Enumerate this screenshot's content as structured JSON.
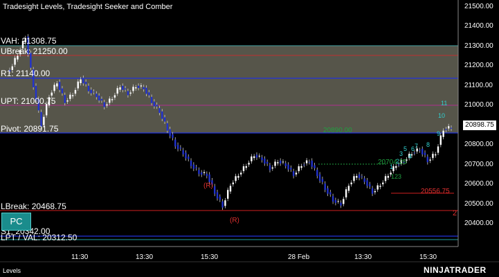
{
  "window": {
    "title": "Tradesight Levels, Tradesight Seeker and Comber",
    "panel_name": "Levels",
    "brand": "NINJATRADER"
  },
  "levels": {
    "vah": "VAH: 21308.75",
    "ubreak": "UBreak: 21250.00",
    "r1": "R1: 21140.00",
    "upt": "UPT: 21000.75",
    "pivot": "Pivot: 20891.75",
    "lbreak": "LBreak: 20468.75",
    "s1": "S1: 20342.00",
    "val": "LPT / VAL: 20312.50"
  },
  "annotations": {
    "r_mark_1": "(R)",
    "r_mark_2": "(R)",
    "ann_20704": "20704.25",
    "ann_20556": "20556.75",
    "ann_20890": "20890.00",
    "seq_11": "11",
    "seq_10": "10",
    "seq_9": "9",
    "seq_8": "8",
    "seq_7": "7",
    "seq_6": "6",
    "seq_5": "5",
    "seq_4": "4",
    "seq_3": "3",
    "seq_2": "2",
    "seq_1": "1",
    "seq_123": "123",
    "right_2": "2"
  },
  "pc_button": "PC",
  "current_price": "20898.75",
  "price_axis": [
    "21500.00",
    "21400.00",
    "21300.00",
    "21200.00",
    "21100.00",
    "21000.00",
    "20900.00",
    "20800.00",
    "20700.00",
    "20600.00",
    "20500.00",
    "20400.00"
  ],
  "time_axis": [
    "11:30",
    "13:30",
    "15:30",
    "28 Feb",
    "13:30",
    "15:30"
  ],
  "colors": {
    "band": "#56554a",
    "blue_line": "#1f2fd0",
    "red_line": "#d02020",
    "teal_line": "#20a0a0",
    "candle": "#ffffff",
    "candle_down": "#2233cc",
    "seeker": "#20a040",
    "comber": "#30c0c0"
  },
  "chart_data": {
    "type": "candlestick",
    "title": "Tradesight Levels, Tradesight Seeker and Comber",
    "ylim": [
      20350,
      21550
    ],
    "y_ticks": [
      21500,
      21400,
      21300,
      21200,
      21100,
      21000,
      20900,
      20800,
      20700,
      20600,
      20500,
      20400
    ],
    "x_ticks": [
      "11:30",
      "13:30",
      "15:30",
      "28 Feb",
      "13:30",
      "15:30"
    ],
    "current_price": 20898.75,
    "levels": [
      {
        "name": "VAH",
        "value": 21308.75
      },
      {
        "name": "UBreak",
        "value": 21250.0
      },
      {
        "name": "R1",
        "value": 21140.0
      },
      {
        "name": "UPT",
        "value": 21000.75
      },
      {
        "name": "Pivot",
        "value": 20891.75
      },
      {
        "name": "LBreak",
        "value": 20468.75
      },
      {
        "name": "S1",
        "value": 20342.0
      },
      {
        "name": "LPT / VAL",
        "value": 20312.5
      }
    ],
    "price_path": [
      21180,
      21260,
      21350,
      21100,
      20900,
      21050,
      21120,
      21020,
      21060,
      21140,
      21080,
      21050,
      21000,
      21040,
      21100,
      21060,
      21100,
      21090,
      21020,
      20970,
      20880,
      20800,
      20760,
      20700,
      20660,
      20650,
      20560,
      20490,
      20600,
      20650,
      20700,
      20750,
      20730,
      20680,
      20720,
      20700,
      20650,
      20700,
      20720,
      20650,
      20580,
      20520,
      20500,
      20600,
      20650,
      20620,
      20560,
      20600,
      20650,
      20700,
      20720,
      20760,
      20780,
      20720,
      20760,
      20880,
      20890
    ]
  }
}
